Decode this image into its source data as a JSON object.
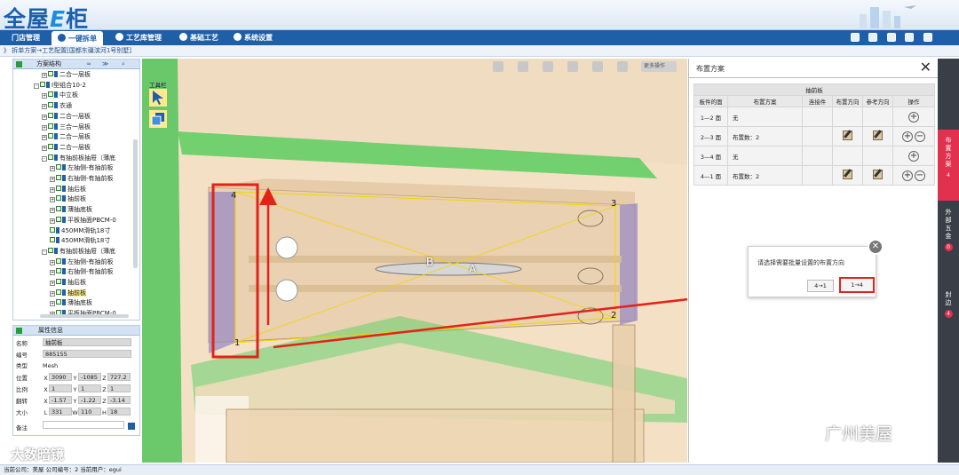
{
  "app": {
    "logo_text": "全屋",
    "logo_e": "E",
    "logo_tail": "柜"
  },
  "menu": {
    "items": [
      {
        "label": "门店管理"
      },
      {
        "label": "一键拆单"
      },
      {
        "label": "工艺库管理"
      },
      {
        "label": "基础工艺"
      },
      {
        "label": "系统设置"
      }
    ],
    "active_index": 1
  },
  "breadcrumb": "》 拆单方案→工艺配置[国都东疆滨河1号别墅]",
  "tree": {
    "title": "方案结构",
    "items": [
      {
        "label": "二合一层板",
        "depth": 2,
        "toggle": "+"
      },
      {
        "label": "I型组合10-2",
        "depth": 1,
        "toggle": "-"
      },
      {
        "label": "中立板",
        "depth": 2,
        "toggle": "+"
      },
      {
        "label": "衣通",
        "depth": 2,
        "toggle": "+"
      },
      {
        "label": "二合一层板",
        "depth": 2,
        "toggle": "+"
      },
      {
        "label": "三合一层板",
        "depth": 2,
        "toggle": "+"
      },
      {
        "label": "二合一层板",
        "depth": 2,
        "toggle": "+"
      },
      {
        "label": "二合一层板",
        "depth": 2,
        "toggle": "+"
      },
      {
        "label": "有抽前板抽屉（薄底",
        "depth": 2,
        "toggle": "-"
      },
      {
        "label": "左抽侧-有抽前板",
        "depth": 3,
        "toggle": "+"
      },
      {
        "label": "右抽侧-有抽前板",
        "depth": 3,
        "toggle": "+"
      },
      {
        "label": "抽后板",
        "depth": 3,
        "toggle": "+"
      },
      {
        "label": "抽前板",
        "depth": 3,
        "toggle": "+"
      },
      {
        "label": "薄抽底板",
        "depth": 3,
        "toggle": "+"
      },
      {
        "label": "平板抽面PBCM-0",
        "depth": 3,
        "toggle": "+"
      },
      {
        "label": "450MM滑轨18寸",
        "depth": 3,
        "toggle": ""
      },
      {
        "label": "450MM滑轨18寸",
        "depth": 3,
        "toggle": ""
      },
      {
        "label": "有抽前板抽屉（薄底",
        "depth": 2,
        "toggle": "-"
      },
      {
        "label": "左抽侧-有抽前板",
        "depth": 3,
        "toggle": "+"
      },
      {
        "label": "右抽侧-有抽前板",
        "depth": 3,
        "toggle": "+"
      },
      {
        "label": "抽后板",
        "depth": 3,
        "toggle": "+"
      },
      {
        "label": "抽前板",
        "depth": 3,
        "toggle": "+",
        "selected": true
      },
      {
        "label": "薄抽底板",
        "depth": 3,
        "toggle": "+"
      },
      {
        "label": "平板抽面PBCM-0",
        "depth": 3,
        "toggle": "+"
      }
    ]
  },
  "props": {
    "title": "属性信息",
    "name_label": "名称",
    "name_value": "抽前板",
    "code_label": "编号",
    "code_value": "885155",
    "type_label": "类型",
    "type_value": "Mesh",
    "pos_label": "位置",
    "pos_x": "3090",
    "pos_y": "-1085",
    "pos_z": "727.2",
    "scale_label": "比例",
    "scale_x": "1",
    "scale_y": "1",
    "scale_z": "1",
    "rot_label": "翻转",
    "rot_x": "-1.57",
    "rot_y": "-1.22",
    "rot_z": "-3.14",
    "size_label": "大小",
    "size_l": "331",
    "size_w": "110",
    "size_h": "18",
    "note_label": "备注",
    "note_value": ""
  },
  "viewport": {
    "toolbox_label": "工具栏",
    "more_ops": "更多操作",
    "markers": {
      "m1": "1",
      "m2": "2",
      "m3": "3",
      "m4": "4",
      "a": "A",
      "b": "B"
    }
  },
  "layout_dialog": {
    "title": "布置方案",
    "caption": "抽前板",
    "headers": [
      "板件的面",
      "布置方案",
      "连接件",
      "布置方向",
      "参考方向",
      "操作"
    ],
    "rows": [
      {
        "face": "1—2 面",
        "plan": "无"
      },
      {
        "face": "2—3 面",
        "plan": "布置数：2"
      },
      {
        "face": "3—4 面",
        "plan": "无"
      },
      {
        "face": "4—1 面",
        "plan": "布置数：2"
      }
    ]
  },
  "side_tabs": [
    {
      "label": "布置方案",
      "badge": "4",
      "active": true
    },
    {
      "label": "外部五金",
      "badge": "0",
      "active": false
    },
    {
      "label": "封边",
      "badge": "4",
      "active": false
    }
  ],
  "direction_popup": {
    "prompt": "请选择需要批量设置的布置方向",
    "option_a": "4→1",
    "option_b": "1→4"
  },
  "status": "当前公司：美屋  公司编号：2  当前用户：egui",
  "watermark_left": "大数暗镜",
  "watermark_right": "广州美屋",
  "colors": {
    "menu_blue": "#1f5fa8",
    "accent_red": "#e2304f",
    "highlight_red": "#e2231a",
    "panel_green": "#2fbf3a"
  }
}
